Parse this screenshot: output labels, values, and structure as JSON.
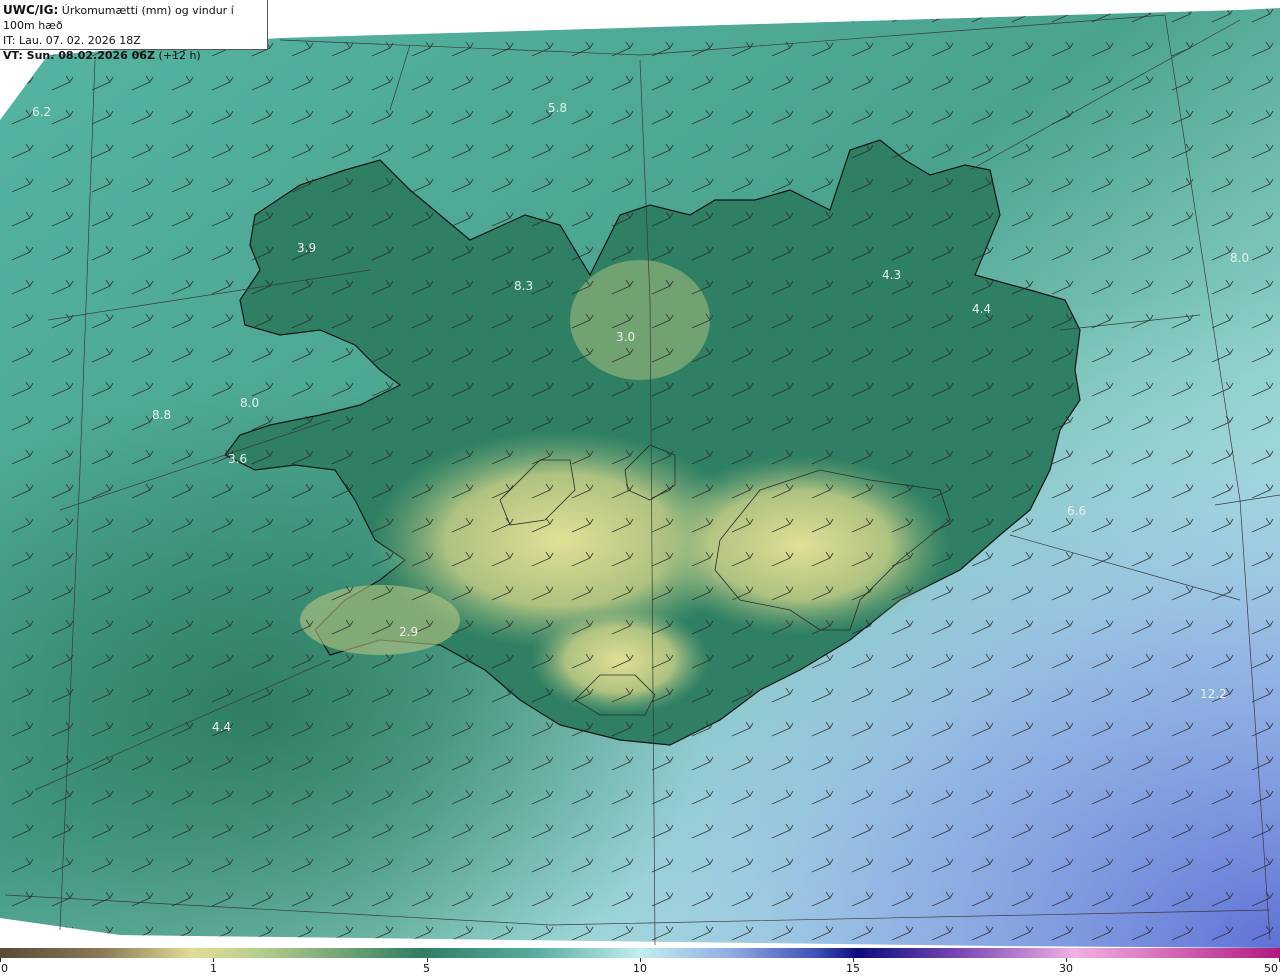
{
  "header": {
    "model": "UWC/IG:",
    "title": "Úrkomumætti (mm) og vindur í 100m hæð",
    "it_line": "IT: Lau. 07. 02. 2026 18Z",
    "vt_prefix": "VT: Sun. 08.02.2026 06Z",
    "vt_suffix": "(+12 h)"
  },
  "value_labels": [
    "6.2",
    "5.8",
    "3.9",
    "8.3",
    "3.0",
    "4.3",
    "4.4",
    "8.0",
    "8.0",
    "8.8",
    "3.6",
    "2.9",
    "4.4",
    "12.2",
    "6.6"
  ],
  "colorbar": {
    "ticks": [
      "0",
      "1",
      "5",
      "10",
      "15",
      "30",
      "50"
    ],
    "colors": [
      "#5a4a36",
      "#8a7a56",
      "#cfc07a",
      "#e8e49a",
      "#a8c98a",
      "#5aa07a",
      "#2e7a66",
      "#4ea598",
      "#8ad4cc",
      "#c8f0ee",
      "#8aa8e0",
      "#3a4ab0",
      "#10108a",
      "#6a3aa8",
      "#c060c0",
      "#f0a8e0",
      "#b01880"
    ],
    "scale": "non-linear"
  },
  "colors": {
    "ocean_low": "#6ec6b6",
    "ocean_high": "#bdeef0",
    "land_green": "#2f7e63",
    "land_yellow": "#d6dc8e",
    "heavy_blue": "#5c6ed0",
    "coastline": "#1a1a1a"
  }
}
